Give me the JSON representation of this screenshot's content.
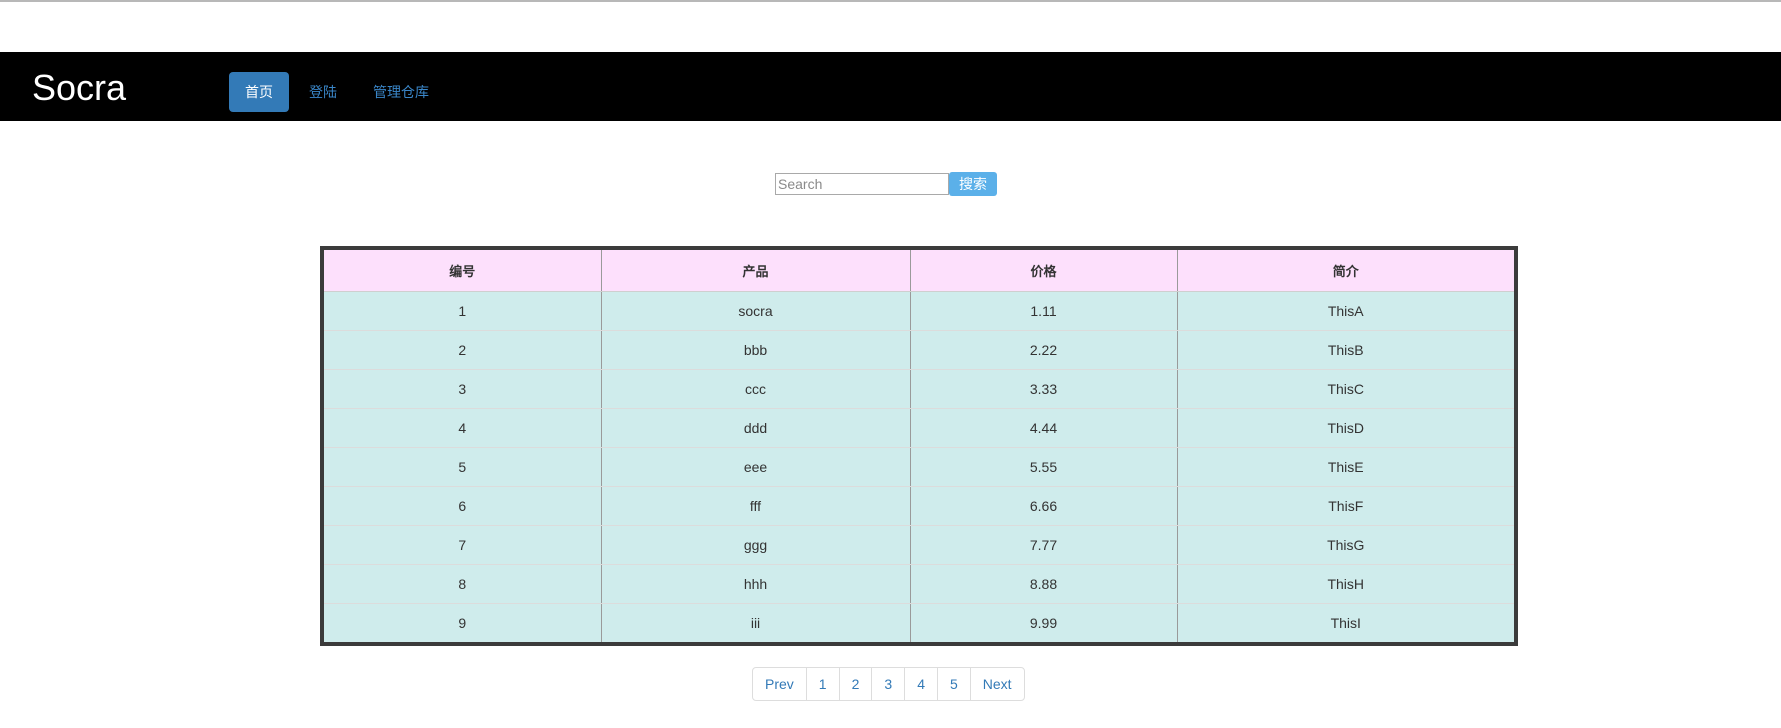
{
  "navbar": {
    "brand": "Socra",
    "items": [
      {
        "label": "首页",
        "active": true
      },
      {
        "label": "登陆",
        "active": false
      },
      {
        "label": "管理仓库",
        "active": false
      }
    ],
    "background": "#000000",
    "active_color": "#337ab7"
  },
  "search": {
    "placeholder": "Search",
    "value": "",
    "button_label": "搜索"
  },
  "table": {
    "headers": [
      "编号",
      "产品",
      "价格",
      "简介"
    ],
    "rows": [
      [
        "1",
        "socra",
        "1.11",
        "ThisA"
      ],
      [
        "2",
        "bbb",
        "2.22",
        "ThisB"
      ],
      [
        "3",
        "ccc",
        "3.33",
        "ThisC"
      ],
      [
        "4",
        "ddd",
        "4.44",
        "ThisD"
      ],
      [
        "5",
        "eee",
        "5.55",
        "ThisE"
      ],
      [
        "6",
        "fff",
        "6.66",
        "ThisF"
      ],
      [
        "7",
        "ggg",
        "7.77",
        "ThisG"
      ],
      [
        "8",
        "hhh",
        "8.88",
        "ThisH"
      ],
      [
        "9",
        "iii",
        "9.99",
        "ThisI"
      ]
    ],
    "header_color": "#fde0fc",
    "row_color": "#cfecec"
  },
  "pagination": {
    "prev_label": "Prev",
    "pages": [
      "1",
      "2",
      "3",
      "4",
      "5"
    ],
    "next_label": "Next"
  }
}
